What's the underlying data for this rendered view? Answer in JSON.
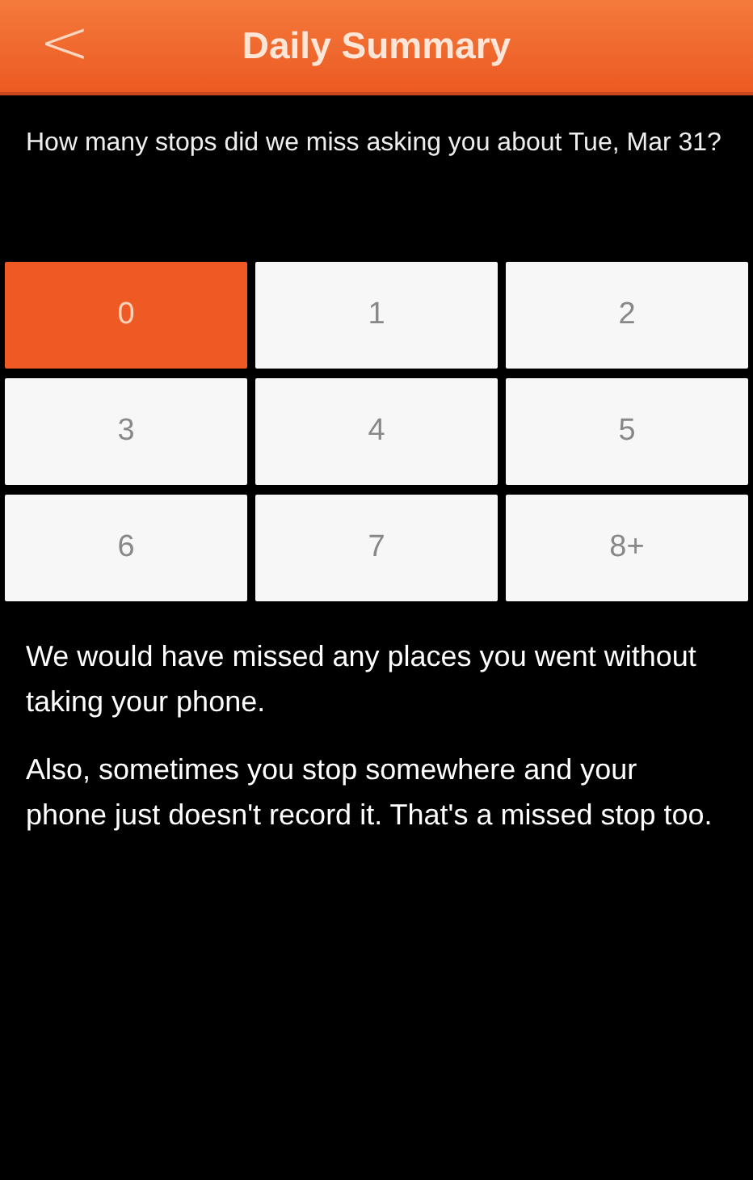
{
  "header": {
    "back": "<",
    "title": "Daily Summary"
  },
  "question": "How many stops did we miss asking you about Tue, Mar 31?",
  "options": [
    {
      "label": "0",
      "selected": true
    },
    {
      "label": "1",
      "selected": false
    },
    {
      "label": "2",
      "selected": false
    },
    {
      "label": "3",
      "selected": false
    },
    {
      "label": "4",
      "selected": false
    },
    {
      "label": "5",
      "selected": false
    },
    {
      "label": "6",
      "selected": false
    },
    {
      "label": "7",
      "selected": false
    },
    {
      "label": "8+",
      "selected": false
    }
  ],
  "notes": [
    "We would have missed any places you went without taking your phone.",
    "Also, sometimes you stop somewhere and your phone just doesn't record it. That's a missed stop too."
  ]
}
